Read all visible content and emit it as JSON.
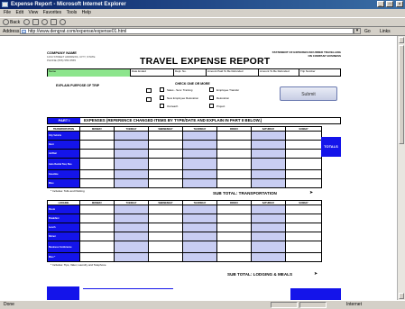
{
  "window": {
    "title": "Expense Report - Microsoft Internet Explorer",
    "buttons": [
      "_",
      "□",
      "×"
    ],
    "menu": [
      "File",
      "Edit",
      "View",
      "Favorites",
      "Tools",
      "Help"
    ]
  },
  "toolbar": {
    "back_label": "Back",
    "icons": [
      "back-icon",
      "forward-icon",
      "stop-icon",
      "refresh-icon",
      "home-icon",
      "search-icon"
    ]
  },
  "address": {
    "label": "Address",
    "url": "http://www.dengrat.com/expense/expense01.html",
    "go_label": "Go",
    "links_label": "Links"
  },
  "status": {
    "left_text": "Done",
    "zone_text": "Internet"
  },
  "form": {
    "company_label": "COMPANY NAME",
    "company_address": [
      "1234 STREET ADDRESS, CITY, STATE",
      "PHONE (555) 555-5555"
    ],
    "title": "TRAVEL EXPENSE REPORT",
    "top_right": [
      "STATEMENT OF EXPENSES INCURRED TRAVELLING",
      "ON COMPANY BUSINESS"
    ],
    "header_cells": [
      "Name",
      "Date Ended",
      "Dept. No.",
      "Amount Paid To Be Refunded",
      "Amount To Be Refunded",
      "Trip Number"
    ],
    "purpose_label": "EXPLAIN PURPOSE OF TRIP",
    "check_header": "CHECK ONE OR MORE",
    "checkboxes": [
      "Sales - Serv. Training",
      "New Employee Relocation",
      "Outreach",
      "Employee Transfer",
      "Relocation",
      "Project"
    ],
    "submit_label": "Submit",
    "part_badge": "PART I",
    "part_text": "EXPENSES (REFERENCE CHANGED ITEMS BY TYPE/DATE AND EXPLAIN IN PART II BELOW.)",
    "day_headers": [
      "MONDAY",
      "TUESDAY",
      "WEDNESDAY",
      "THURSDAY",
      "FRIDAY",
      "SATURDAY",
      "SUNDAY"
    ],
    "transport_header": "TRANSPORTATION",
    "transport_rows": [
      "City Vehicle",
      "Rent",
      "Air/Rail",
      "Auto Rental\nTaxi, Bus",
      "Gasoline",
      "Misc."
    ],
    "totals_label": "TOTALS",
    "transport_note": "* Includes: Tolls and Parking",
    "subtotal_transport": "SUB TOTAL: TRANSPORTATION",
    "lodging_header": "LODGING",
    "lodging_rows": [
      "Room",
      "Breakfast",
      "Lunch",
      "Dinner",
      "Business\nConference",
      "Misc.*"
    ],
    "lodging_note": "* Includes: Tips, Valet, Laundry and Telephone",
    "subtotal_lodging": "SUB TOTAL: LODGING & MEALS"
  }
}
